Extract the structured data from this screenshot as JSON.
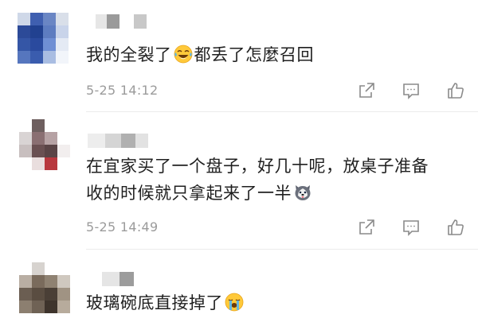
{
  "comments": [
    {
      "text_before_emoji": "我的全裂了",
      "emoji": "tears-of-joy-emoji",
      "text_after_emoji": "都丢了怎麼召回",
      "timestamp": "5-25 14:12"
    },
    {
      "text_line1": "在宜家买了一个盘子，好几十呢，放桌子准备",
      "text_line2": "收的时候就只拿起来了一半",
      "emoji": "husky-dog-emoji",
      "timestamp": "5-25 14:49"
    },
    {
      "text": "玻璃碗底直接掉了",
      "emoji": "loudly-crying-emoji"
    }
  ],
  "actions": {
    "share_icon": "share-icon",
    "comment_icon": "comment-icon",
    "like_icon": "thumbs-up-icon"
  },
  "colors": {
    "text": "#1f1f1f",
    "timestamp": "#9b9b9b",
    "icon": "#8a8a8a",
    "divider": "#ececec"
  }
}
